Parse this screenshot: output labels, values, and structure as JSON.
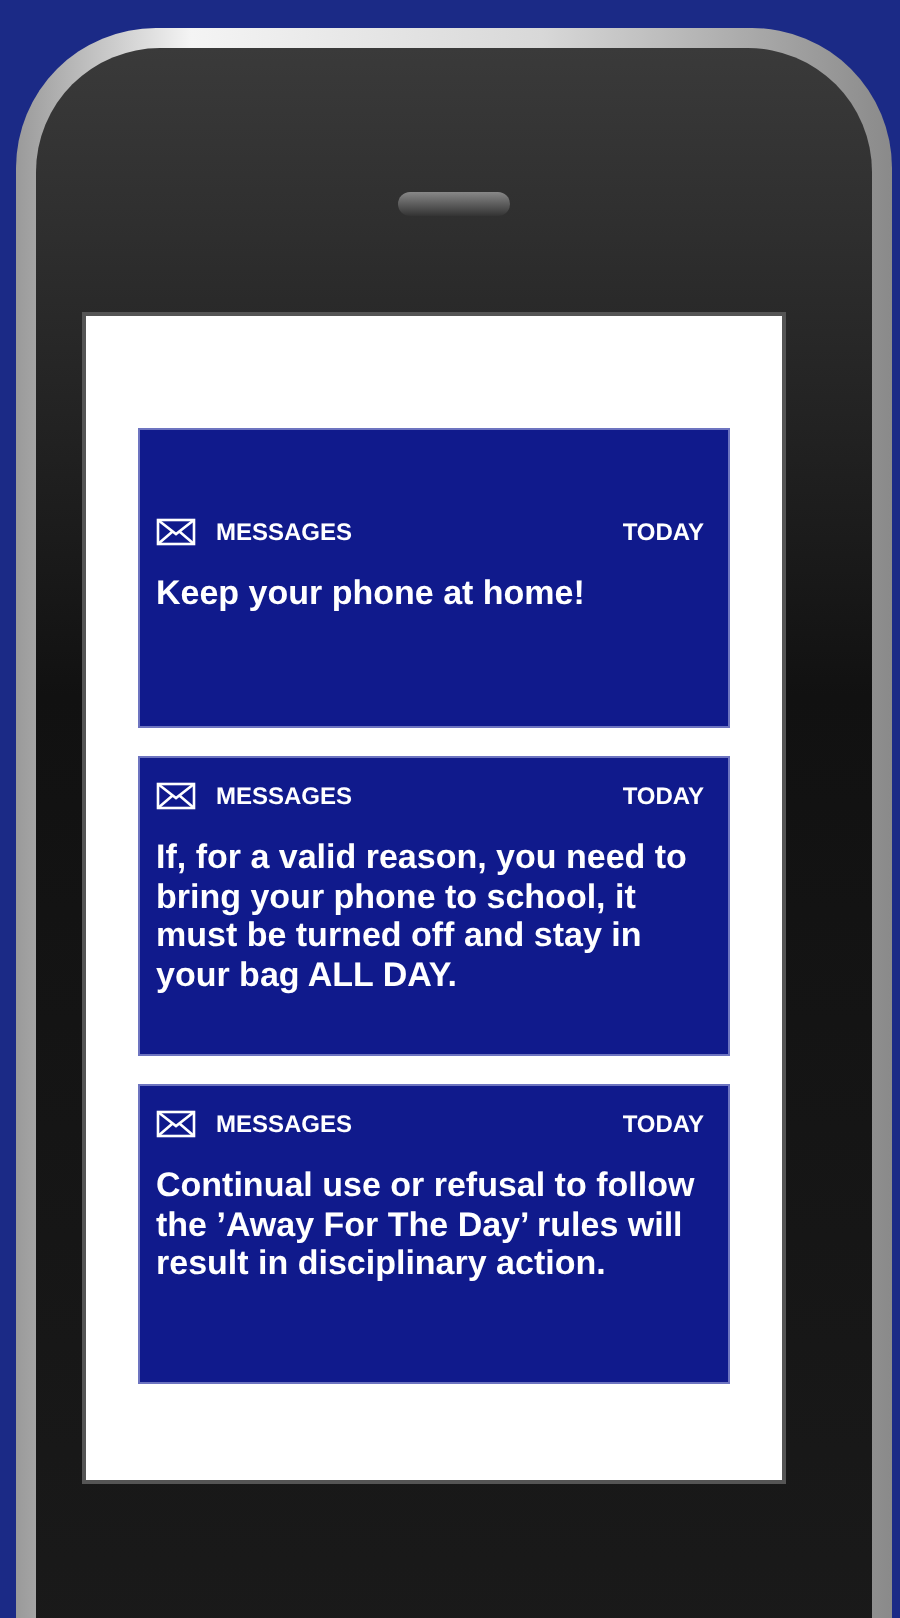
{
  "notifications": [
    {
      "app": "MESSAGES",
      "time": "TODAY",
      "text": "Keep your phone at home!"
    },
    {
      "app": "MESSAGES",
      "time": "TODAY",
      "text": "If, for a valid reason, you need to bring your phone to school, it must be turned off and stay in your bag ALL DAY."
    },
    {
      "app": "MESSAGES",
      "time": "TODAY",
      "text": "Continual use or refusal to follow the ’Away For The Day’ rules will result in disciplinary action."
    }
  ]
}
